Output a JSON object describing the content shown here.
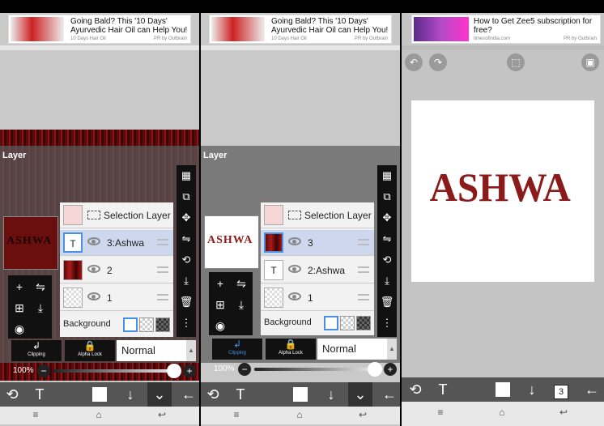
{
  "ad_left": {
    "headline": "Going Bald? This '10 Days'\nAyurvedic Hair Oil can Help You!",
    "source": "10 Days Hair Oil",
    "outbrain": "PR by Outbrain"
  },
  "ad_right": {
    "headline": "How to Get Zee5 subscription for\nfree?",
    "source": "timesofindia.com",
    "outbrain": "PR by Outbrain"
  },
  "layer_panel": {
    "title": "Layer",
    "background_label": "Background",
    "clipping_label": "Clipping",
    "alpha_lock_label": "Alpha Lock",
    "blend_mode": "Normal",
    "opacity_text": "100%",
    "opacity": 1.0
  },
  "panel1": {
    "layers": [
      {
        "name": "Selection Layer",
        "kind": "selection"
      },
      {
        "name": "3:Ashwa",
        "kind": "text",
        "selected": true
      },
      {
        "name": "2",
        "kind": "red"
      },
      {
        "name": "1",
        "kind": "transparent"
      }
    ]
  },
  "panel2": {
    "layers": [
      {
        "name": "Selection Layer",
        "kind": "selection"
      },
      {
        "name": "3",
        "kind": "red",
        "selected": true
      },
      {
        "name": "2:Ashwa",
        "kind": "text"
      },
      {
        "name": "1",
        "kind": "transparent"
      }
    ]
  },
  "artwork_text": "ASHWA",
  "thumb_text": "ASHWA",
  "layer_count_badge": "3",
  "icons": {
    "transform": "transform-icon",
    "text": "T",
    "undo": "undo-icon",
    "redo": "redo-icon",
    "selection": "selection-icon",
    "gallery": "gallery-icon",
    "back": "back-arrow-icon"
  },
  "colors": {
    "toolbar": "#555555",
    "panel": "#7a7a7a",
    "accent": "#4a90e2",
    "art_red": "#8b1a1a"
  }
}
